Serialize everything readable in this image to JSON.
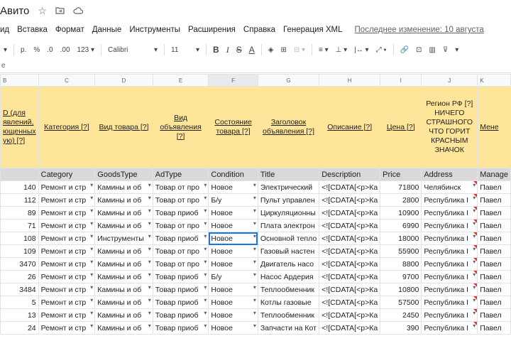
{
  "title_bar": {
    "doc_title": "Авито",
    "icons": [
      "star-icon",
      "move-to-folder-icon",
      "cloud-status-icon"
    ]
  },
  "menu": {
    "items": [
      "ид",
      "Вставка",
      "Формат",
      "Данные",
      "Инструменты",
      "Расширения",
      "Справка",
      "Генерация XML"
    ],
    "last_edit": "Последнее изменение: 10 августа"
  },
  "toolbar": {
    "currency": "р.",
    "percent": "%",
    "dec_less": ".0",
    "dec_more": ".00",
    "format_more": "123",
    "font": "Calibri",
    "font_size": "11",
    "bold": "B",
    "italic": "I",
    "strike": "S",
    "text_color": "A"
  },
  "formula_bar": {
    "value": "е"
  },
  "columns": {
    "letters": [
      "B",
      "C",
      "D",
      "E",
      "F",
      "G",
      "H",
      "I",
      "J",
      "K"
    ]
  },
  "header_row": {
    "b": "D (для явлений, ющенных ую) [?]",
    "c": "Категория [?]",
    "d": "Вид товара [?]",
    "e": "Вид объявления [?]",
    "f": "Состояние товара [?]",
    "g": "Заголовок объявления [?]",
    "h": "Описание [?]",
    "i": "Цена [?]",
    "j": "Регион РФ [?] НИЧЕГО СТРАШНОГО ЧТО ГОРИТ КРАСНЫМ ЗНАЧОК",
    "k": "Мене"
  },
  "code_row": [
    "",
    "Category",
    "GoodsType",
    "AdType",
    "Condition",
    "Title",
    "Description",
    "Price",
    "Address",
    "Manage"
  ],
  "rows": [
    {
      "b": "140",
      "c": "Ремонт и стр",
      "d": "Камины и об",
      "e": "Товар от про",
      "f": "Новое",
      "g": "Электрический",
      "h": "<![CDATA[<p>Ка",
      "i": "71800",
      "j": "Челябинск",
      "k": "Павел"
    },
    {
      "b": "112",
      "c": "Ремонт и стр",
      "d": "Камины и об",
      "e": "Товар от про",
      "f": "Б/у",
      "g": "Пульт управлен",
      "h": "<![CDATA[<p>Ка",
      "i": "2800",
      "j": "Республика I",
      "k": "Павел"
    },
    {
      "b": "89",
      "c": "Ремонт и стр",
      "d": "Камины и об",
      "e": "Товар приоб",
      "f": "Новое",
      "g": "Циркуляционны",
      "h": "<![CDATA[<p>Ка",
      "i": "10900",
      "j": "Республика I",
      "k": "Павел"
    },
    {
      "b": "71",
      "c": "Ремонт и стр",
      "d": "Камины и об",
      "e": "Товар от про",
      "f": "Новое",
      "g": "Плата электрон",
      "h": "<![CDATA[<p>Ка",
      "i": "6990",
      "j": "Республика I",
      "k": "Павел"
    },
    {
      "b": "108",
      "c": "Ремонт и стр",
      "d": "Инструменты",
      "e": "Товар приоб",
      "f": "Новое",
      "g": "Основной тепло",
      "h": "<![CDATA[<p>Ка",
      "i": "18000",
      "j": "Республика I",
      "k": "Павел"
    },
    {
      "b": "109",
      "c": "Ремонт и стр",
      "d": "Камины и об",
      "e": "Товар от про",
      "f": "Новое",
      "g": "Газовый настен",
      "h": "<![CDATA[<p>Ка",
      "i": "55900",
      "j": "Республика I",
      "k": "Павел"
    },
    {
      "b": "3470",
      "c": "Ремонт и стр",
      "d": "Камины и об",
      "e": "Товар от про",
      "f": "Новое",
      "g": "Двигатель насо",
      "h": "<![CDATA[<p>Ка",
      "i": "8800",
      "j": "Республика I",
      "k": "Павел"
    },
    {
      "b": "26",
      "c": "Ремонт и стр",
      "d": "Камины и об",
      "e": "Товар приоб",
      "f": "Б/у",
      "g": "Насос Ардерия",
      "h": "<![CDATA[<p>Ка",
      "i": "9700",
      "j": "Республика I",
      "k": "Павел"
    },
    {
      "b": "3484",
      "c": "Ремонт и стр",
      "d": "Камины и об",
      "e": "Товар приоб",
      "f": "Новое",
      "g": "Теплообменник",
      "h": "<![CDATA[<p>Ка",
      "i": "10800",
      "j": "Республика I",
      "k": "Павел"
    },
    {
      "b": "5",
      "c": "Ремонт и стр",
      "d": "Камины и об",
      "e": "Товар приоб",
      "f": "Новое",
      "g": "Котлы газовые",
      "h": "<![CDATA[<p>Ка",
      "i": "57500",
      "j": "Республика I",
      "k": "Павел"
    },
    {
      "b": "13",
      "c": "Ремонт и стр",
      "d": "Камины и об",
      "e": "Товар приоб",
      "f": "Новое",
      "g": "Теплообменник",
      "h": "<![CDATA[<p>Ка",
      "i": "2450",
      "j": "Республика I",
      "k": "Павел"
    },
    {
      "b": "24",
      "c": "Ремонт и стр",
      "d": "Камины и об",
      "e": "Товар приоб",
      "f": "Новое",
      "g": "Запчасти на Кот",
      "h": "<![CDATA[<p>Ка",
      "i": "390",
      "j": "Республика I",
      "k": "Павел"
    }
  ]
}
